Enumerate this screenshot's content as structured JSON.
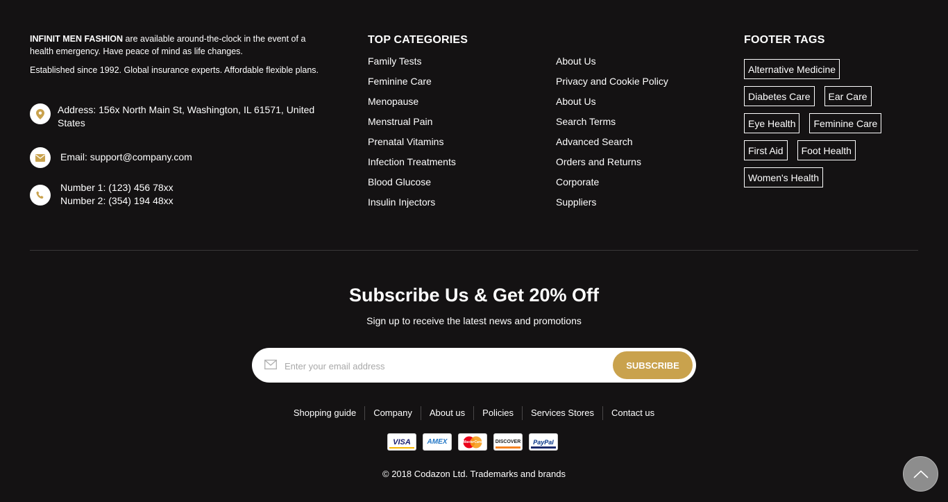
{
  "about": {
    "brand": "INFINIT MEN FASHION",
    "text1": "are available around-the-clock in the event of a health emergency. Have peace of mind as life changes.",
    "text2": "Established since 1992. Global insurance experts. Affordable flexible plans."
  },
  "contact": {
    "address": "Address: 156x North Main St, Washington, IL 61571, United States",
    "email": "Email: support@company.com",
    "phone1": "Number 1: (123) 456 78xx",
    "phone2": "Number 2: (354) 194 48xx",
    "icons": [
      "map-pin-icon",
      "envelope-icon",
      "phone-icon"
    ],
    "icon_color": "#c9a24d"
  },
  "categories": {
    "title": "TOP CATEGORIES",
    "col1": [
      "Family Tests",
      "Feminine Care",
      "Menopause",
      "Menstrual Pain",
      "Prenatal Vitamins",
      "Infection Treatments",
      "Blood Glucose",
      "Insulin Injectors"
    ],
    "col2": [
      "About Us",
      "Privacy and Cookie Policy",
      "About Us",
      "Search Terms",
      "Advanced Search",
      "Orders and Returns",
      "Corporate",
      "Suppliers"
    ]
  },
  "tags": {
    "title": "FOOTER TAGS",
    "rows": [
      [
        "Alternative Medicine"
      ],
      [
        "Diabetes Care",
        "Ear Care"
      ],
      [
        "Eye Health",
        "Feminine Care"
      ],
      [
        "First Aid",
        "Foot Health"
      ],
      [
        "Women's Health"
      ]
    ]
  },
  "subscribe": {
    "title": "Subscribe Us & Get 20% Off",
    "subtitle": "Sign up to receive the latest news and promotions",
    "placeholder": "Enter your email address",
    "button": "SUBSCRIBE",
    "accent": "#c9a24d"
  },
  "bottom_nav": [
    "Shopping guide",
    "Company",
    "About us",
    "Policies",
    "Services Stores",
    "Contact us"
  ],
  "payments": [
    "VISA",
    "AMEX",
    "MasterCard",
    "DISCOVER",
    "PayPal"
  ],
  "copyright": "© 2018 Codazon Ltd. Trademarks and brands",
  "colors": {
    "background": "#141213",
    "text": "#ffffff",
    "divider": "#3a3839",
    "scroll_top": "#8d8d8d"
  }
}
